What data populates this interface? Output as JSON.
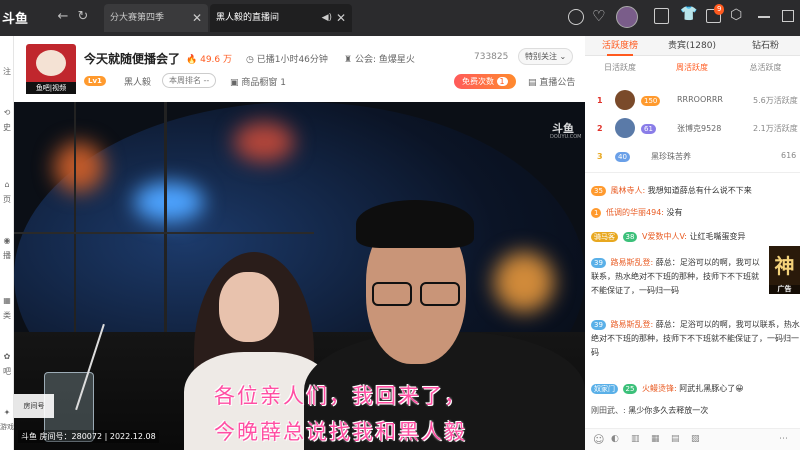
{
  "app": {
    "logo": "斗鱼"
  },
  "tabs": [
    {
      "label": "分大赛第四季",
      "active": false
    },
    {
      "label": "黑人毅的直播间",
      "active": true
    }
  ],
  "topbar": {
    "notification_count": "9"
  },
  "rail": [
    "注",
    "史",
    "页",
    "播",
    "类",
    "吧",
    "游戏"
  ],
  "header": {
    "title": "今天就随便播会了",
    "heat": "49.6 万",
    "duration": "已播1小时46分钟",
    "guild": "公会: 鱼爆星火",
    "streamer": "黑人毅",
    "level": "Lv1",
    "rank_button": "本周排名 --",
    "shop": "商品橱窗 1",
    "room_number": "733825",
    "follow_label": "特别关注",
    "free_label": "免费次数",
    "free_count": "1",
    "announce_label": "直播公告",
    "avatar_caption": "鱼吧|视频"
  },
  "video": {
    "watermark": "斗鱼",
    "watermark_sub": "DOUYU.COM",
    "subtitle_line1": "各位亲人们，我回来了，",
    "subtitle_line2": "今晚薛总说找我和黑人毅",
    "room_info": "斗鱼  房间号：280072 | 2022.12.08",
    "room_badge": "房间号"
  },
  "right": {
    "main_tabs": [
      "活跃度榜",
      "贵宾(1280)",
      "钻石粉"
    ],
    "sub_tabs": [
      "日活跃度",
      "周活跃度",
      "总活跃度"
    ],
    "ranks": [
      {
        "pos": "1",
        "level": "150",
        "name": "RRROORRR",
        "value": "5.6万活跃度"
      },
      {
        "pos": "2",
        "level": "61",
        "name": "张博克9528",
        "value": "2.1万活跃度"
      },
      {
        "pos": "3",
        "level": "40",
        "name": "黑珍珠苦养",
        "value": "616"
      }
    ],
    "chat": [
      {
        "level": "35",
        "user": "風林寺人:",
        "text": "我想知道薛总有什么说不下来"
      },
      {
        "level": "1",
        "user": "低调的华丽494:",
        "text": "没有"
      },
      {
        "level": "38",
        "user": "V爱数中人V:",
        "text": "让红毛嘴蛋变异"
      },
      {
        "level": "39",
        "user": "路易斯乱登:",
        "text": "薛总：足浴可以的啊，我可以联系，热水绝对不下班的那种，技师下不下班就不能保证了，一码归一码"
      },
      {
        "level": "39",
        "user": "路易斯乱登:",
        "text": "薛总：足浴可以的啊，我可以联系，热水绝对不下班的那种，技师下不下班就不能保证了，一码归一码"
      },
      {
        "level": "25",
        "user": "火鳗烫锋:",
        "text": "阿武扎黑豚心了😀"
      },
      {
        "level": "",
        "user": "刚田武、:",
        "text": "黑少你多久去释放一次"
      }
    ],
    "badge_tag": "骑马客",
    "ad_text": "神",
    "ad_label": "广告"
  },
  "colors": {
    "accent": "#ff5a1f",
    "subtitle": "#ff4fa3",
    "chat_user": "#e95c24"
  }
}
